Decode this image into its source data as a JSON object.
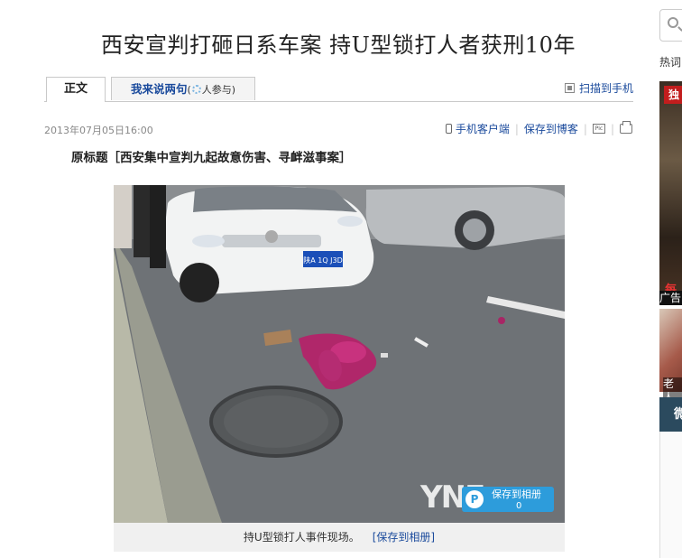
{
  "article": {
    "headline": "西安宣判打砸日系车案 持U型锁打人者获刑10年",
    "date": "2013年07月05日16:00",
    "original_title": "原标题［西安集中宣判九起故意伤害、寻衅滋事案］"
  },
  "tabs": {
    "main": "正文",
    "comment_label": "我来说两句",
    "comment_paren_open": "(",
    "comment_count_suffix": "人参与)",
    "scan_to_phone": "扫描到手机"
  },
  "tools": {
    "mobile_client": "手机客户端",
    "save_to_blog": "保存到博客",
    "pic_icon": "Pic"
  },
  "figure": {
    "caption": "持U型锁打人事件现场。",
    "save_link": "[保存到相册]",
    "save_album_button": "保存到相册",
    "save_album_count": "0",
    "watermark": "YNE",
    "plate": "陕A 1Q J3D"
  },
  "sidebar": {
    "hot_label": "热词",
    "ad_badge": "独",
    "ad_red_text": "每",
    "ad_label": "广告",
    "ad2_text": "老人",
    "weibo_label": "微"
  },
  "icons": [
    "search-icon",
    "qr-code-icon",
    "phone-icon",
    "picture-icon",
    "print-icon",
    "loading-icon"
  ],
  "colors": {
    "link": "#1a4a9c",
    "save_album": "#2d9cdb",
    "ad_badge": "#c21d1d"
  }
}
